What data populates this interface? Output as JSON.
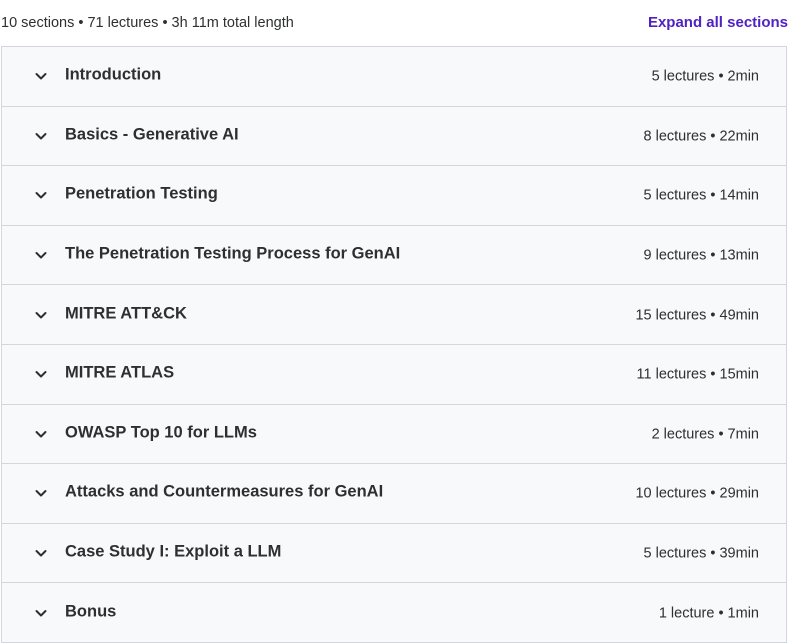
{
  "header": {
    "summary": "10 sections • 71 lectures • 3h 11m total length",
    "expand_all_label": "Expand all sections",
    "accent_color": "#5022c3"
  },
  "sections": [
    {
      "title": "Introduction",
      "meta": "5 lectures • 2min"
    },
    {
      "title": "Basics - Generative AI",
      "meta": "8 lectures • 22min"
    },
    {
      "title": "Penetration Testing",
      "meta": "5 lectures • 14min"
    },
    {
      "title": "The Penetration Testing Process for GenAI",
      "meta": "9 lectures • 13min"
    },
    {
      "title": "MITRE ATT&CK",
      "meta": "15 lectures • 49min"
    },
    {
      "title": "MITRE ATLAS",
      "meta": "11 lectures • 15min"
    },
    {
      "title": "OWASP Top 10 for LLMs",
      "meta": "2 lectures • 7min"
    },
    {
      "title": "Attacks and Countermeasures for GenAI",
      "meta": "10 lectures • 29min"
    },
    {
      "title": "Case Study I: Exploit a LLM",
      "meta": "5 lectures • 39min"
    },
    {
      "title": "Bonus",
      "meta": "1 lecture • 1min"
    }
  ],
  "icons": {
    "section_toggle": "chevron-down-icon"
  }
}
